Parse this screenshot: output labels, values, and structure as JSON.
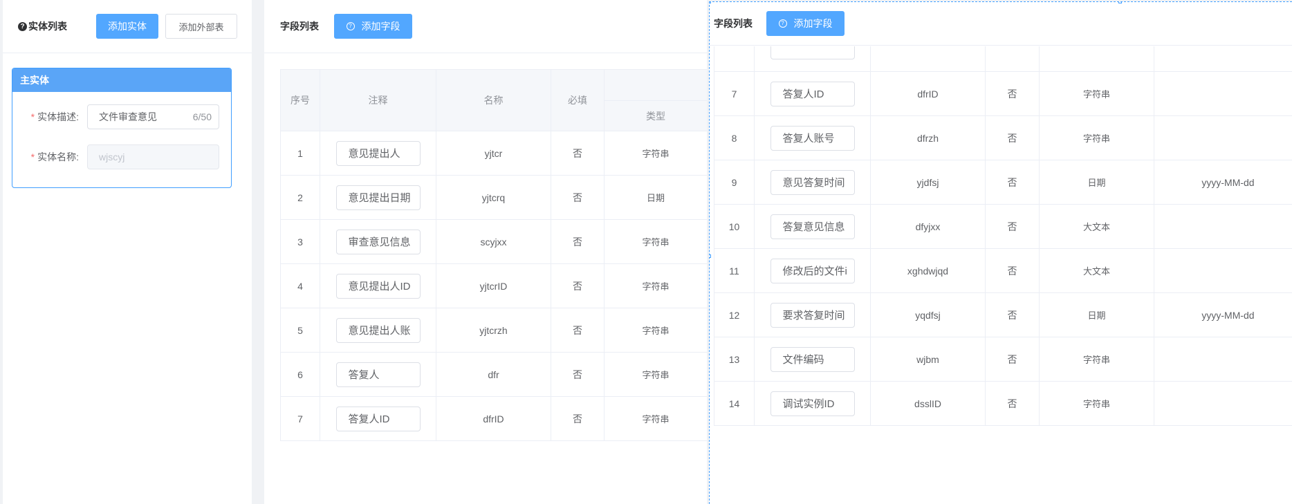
{
  "left": {
    "title": "实体列表",
    "add_entity": "添加实体",
    "add_external": "添加外部表",
    "card_title": "主实体",
    "desc_label": "实体描述:",
    "desc_value": "文件审查意见",
    "desc_count": "6/50",
    "name_label": "实体名称:",
    "name_value": "wjscyj"
  },
  "middle": {
    "title": "字段列表",
    "add_field": "添加字段",
    "headers": {
      "index": "序号",
      "comment": "注释",
      "name": "名称",
      "required": "必填",
      "type": "类型"
    },
    "rows": [
      {
        "index": "1",
        "comment": "意见提出人",
        "name": "yjtcr",
        "required": "否",
        "type": "字符串"
      },
      {
        "index": "2",
        "comment": "意见提出日期",
        "name": "yjtcrq",
        "required": "否",
        "type": "日期"
      },
      {
        "index": "3",
        "comment": "审查意见信息",
        "name": "scyjxx",
        "required": "否",
        "type": "字符串"
      },
      {
        "index": "4",
        "comment": "意见提出人ID",
        "name": "yjtcrID",
        "required": "否",
        "type": "字符串"
      },
      {
        "index": "5",
        "comment": "意见提出人账",
        "name": "yjtcrzh",
        "required": "否",
        "type": "字符串"
      },
      {
        "index": "6",
        "comment": "答复人",
        "name": "dfr",
        "required": "否",
        "type": "字符串"
      },
      {
        "index": "7",
        "comment": "答复人ID",
        "name": "dfrID",
        "required": "否",
        "type": "字符串"
      }
    ]
  },
  "right": {
    "title": "字段列表",
    "add_field": "添加字段",
    "rows": [
      {
        "index": "7",
        "comment": "答复人ID",
        "name": "dfrID",
        "required": "否",
        "type": "字符串",
        "format": ""
      },
      {
        "index": "8",
        "comment": "答复人账号",
        "name": "dfrzh",
        "required": "否",
        "type": "字符串",
        "format": ""
      },
      {
        "index": "9",
        "comment": "意见答复时间",
        "name": "yjdfsj",
        "required": "否",
        "type": "日期",
        "format": "yyyy-MM-dd"
      },
      {
        "index": "10",
        "comment": "答复意见信息",
        "name": "dfyjxx",
        "required": "否",
        "type": "大文本",
        "format": ""
      },
      {
        "index": "11",
        "comment": "修改后的文件i",
        "name": "xghdwjqd",
        "required": "否",
        "type": "大文本",
        "format": ""
      },
      {
        "index": "12",
        "comment": "要求答复时间",
        "name": "yqdfsj",
        "required": "否",
        "type": "日期",
        "format": "yyyy-MM-dd"
      },
      {
        "index": "13",
        "comment": "文件编码",
        "name": "wjbm",
        "required": "否",
        "type": "字符串",
        "format": ""
      },
      {
        "index": "14",
        "comment": "调试实例ID",
        "name": "dsslID",
        "required": "否",
        "type": "字符串",
        "format": ""
      }
    ]
  }
}
